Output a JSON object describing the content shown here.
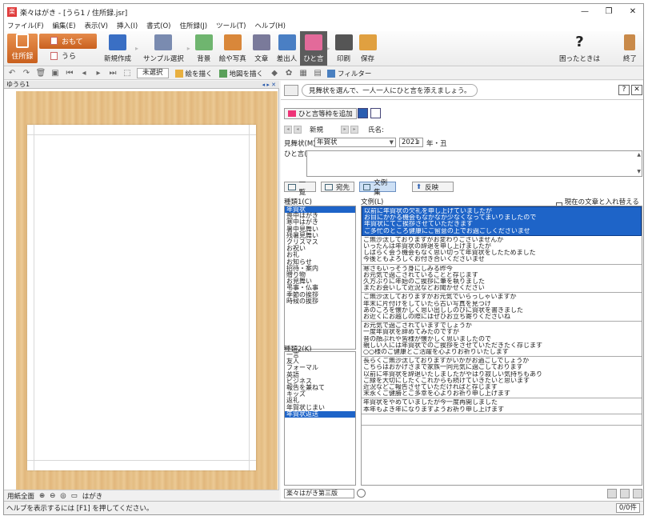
{
  "window": {
    "title": "楽々はがき - [うら1 / 住所録.jsr]",
    "min": "—",
    "max": "❐",
    "close": "✕"
  },
  "menu": [
    "ファイル(F)",
    "編集(E)",
    "表示(V)",
    "挿入(I)",
    "書式(O)",
    "住所録(J)",
    "ツール(T)",
    "ヘルプ(H)"
  ],
  "ribbon": {
    "jusho": "住所録",
    "omote": "おもて",
    "ura": "うら",
    "buttons": [
      {
        "label": "新規作成",
        "color": "#3a6fc4"
      },
      {
        "label": "サンプル選択",
        "color": "#7a8bb0"
      },
      {
        "label": "背景",
        "color": "#6fb56f"
      },
      {
        "label": "絵や写真",
        "color": "#d9873a"
      },
      {
        "label": "文章",
        "color": "#7a7a9a"
      },
      {
        "label": "差出人",
        "color": "#4a7fc4"
      },
      {
        "label": "ひと言",
        "color": "#e36a9a",
        "active": true
      },
      {
        "label": "印刷",
        "color": "#555555"
      },
      {
        "label": "保存",
        "color": "#e0a040"
      }
    ],
    "help": "困ったときは",
    "help_icon": "?",
    "end": "終了"
  },
  "toolbar2": {
    "unselected": "未選択",
    "draw": "絵を描く",
    "map": "地図を描く",
    "filter": "フィルター"
  },
  "left": {
    "tab": "ゆうら1",
    "nav": "◂ ▸ ✕",
    "zoom": "用紙全面",
    "card_label": "はがき"
  },
  "right": {
    "hint": "見舞状を選んで、一人一人にひと言を添えましょう。",
    "help": "?",
    "close": "✕",
    "add_button": "ひと言等枠を追加",
    "nav_new": "新規",
    "name_label": "氏名:",
    "mimai_label": "見舞状(M)",
    "mimai_value": "年賀状",
    "year": "2021",
    "year_suffix": "年・丑",
    "hitokoto_label": "ひと言(J)",
    "tabs": {
      "ichiran": "一覧",
      "atesaki": "宛先",
      "bunrei": "文例集",
      "hanei": "反映"
    },
    "cat1_label": "種類1(C)",
    "cat1": [
      "年賀状",
      "喪中はがき",
      "寒中はがき",
      "暑中見舞い",
      "残暑見舞い",
      "クリスマス",
      "お祝い",
      "お礼",
      "お知らせ",
      "招待・案内",
      "贈り物",
      "お見舞い",
      "弔事・仏事",
      "季節の挨拶",
      "時候の挨拶"
    ],
    "cat1_selected": 0,
    "cat2_label": "種類2(K)",
    "cat2": [
      "一言",
      "友人",
      "フォーマル",
      "英語",
      "ビジネス",
      "報告を兼ねて",
      "キッズ",
      "返礼",
      "年賀状じまい",
      "年賀状返送"
    ],
    "cat2_selected": 9,
    "bunrei_label": "文例(L)",
    "replace_label": "現在の文章と入れ替える(G)",
    "bunrei": [
      [
        "以前に年賀状の欠礼を申し上げていましたが",
        "お目にかかる機会もなかなか少なくなってまいりましたので",
        "年賀状にてご挨拶させていただきます",
        "ご多忙のところ健康にご留意の上でお過ごしくださいませ"
      ],
      [
        "ご無沙汰しておりますがお変わりございませんか",
        "いったんは年賀状の辞退を申し上げましたが",
        "しばらく会う機会もなく思い切って年賀状をしたためました",
        "今後ともよろしくお付き合いくださいませ"
      ],
      [
        "寒さもいっそう身にしみる昨今",
        "お元気で過ごされていることと存じます",
        "久方ぶりに年始のご挨拶に筆を執りました",
        "またお会いして近況などお聞かせください"
      ],
      [
        "ご無沙汰しておりますがお元気でいらっしゃいますか",
        "年末に片付けをしていたら古い写真を見つけ",
        "あのころを懐かしく思い出ししのびに賀状を書きました",
        "お近くにお越しの際にはぜひお立ち寄りくださいね"
      ],
      [
        "お元気で過ごされていますでしょうか",
        "一度年賀状を辞めてみたのですが",
        "昔の顔ぶれや皆様が懐かしく思いましたので",
        "親しい人には年賀状でのご挨拶をさせていただきたく存じます",
        "○○様のご健康とご活躍を心よりお祈りいたします"
      ],
      [
        "長らくご無沙汰しておりますがいかがお過ごしでしょうか",
        "こちらはおかげさまで家族一同元気に過ごしております",
        "以前に年賀状を辞退いたしましたがやはり寂しい気持ちもあり",
        "ご縁を大切にしたくこれからも続けていきたいと思います",
        "近況などご報告させていただければと存じます",
        "末永くご健勝とご多幸を心よりお祈り申し上げます"
      ],
      [
        "年賀状をやめていましたが今一度再開しました",
        "本年もよき年になりますようお祈り申し上げます"
      ],
      []
    ],
    "font": "楽々はがき第三版"
  },
  "status": {
    "help": "ヘルプを表示するには [F1] を押してください。",
    "count": "0/0件"
  }
}
